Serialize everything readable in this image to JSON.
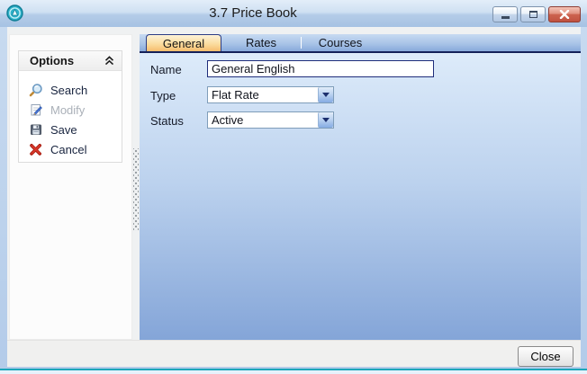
{
  "window": {
    "title": "3.7 Price Book",
    "controls": {
      "minimize": "minimize",
      "maximize": "maximize",
      "close": "close"
    }
  },
  "sidebar": {
    "header": "Options",
    "collapse_icon": "chevron-double-up",
    "items": [
      {
        "label": "Search",
        "icon": "search-icon",
        "enabled": true
      },
      {
        "label": "Modify",
        "icon": "modify-icon",
        "enabled": false
      },
      {
        "label": "Save",
        "icon": "save-icon",
        "enabled": true
      },
      {
        "label": "Cancel",
        "icon": "cancel-icon",
        "enabled": true
      }
    ]
  },
  "tabs": [
    {
      "label": "General",
      "active": true
    },
    {
      "label": "Rates",
      "active": false
    },
    {
      "label": "Courses",
      "active": false
    }
  ],
  "form": {
    "fields": [
      {
        "label": "Name",
        "type": "text",
        "value": "General English"
      },
      {
        "label": "Type",
        "type": "dropdown",
        "value": "Flat Rate"
      },
      {
        "label": "Status",
        "type": "dropdown",
        "value": "Active"
      }
    ]
  },
  "footer": {
    "close_label": "Close"
  },
  "colors": {
    "accent_teal": "#1ca6ba",
    "active_tab_orange": "#f6bd6d",
    "frame_blue": "#bcd2ec",
    "navy_border": "#1f2d7b"
  }
}
